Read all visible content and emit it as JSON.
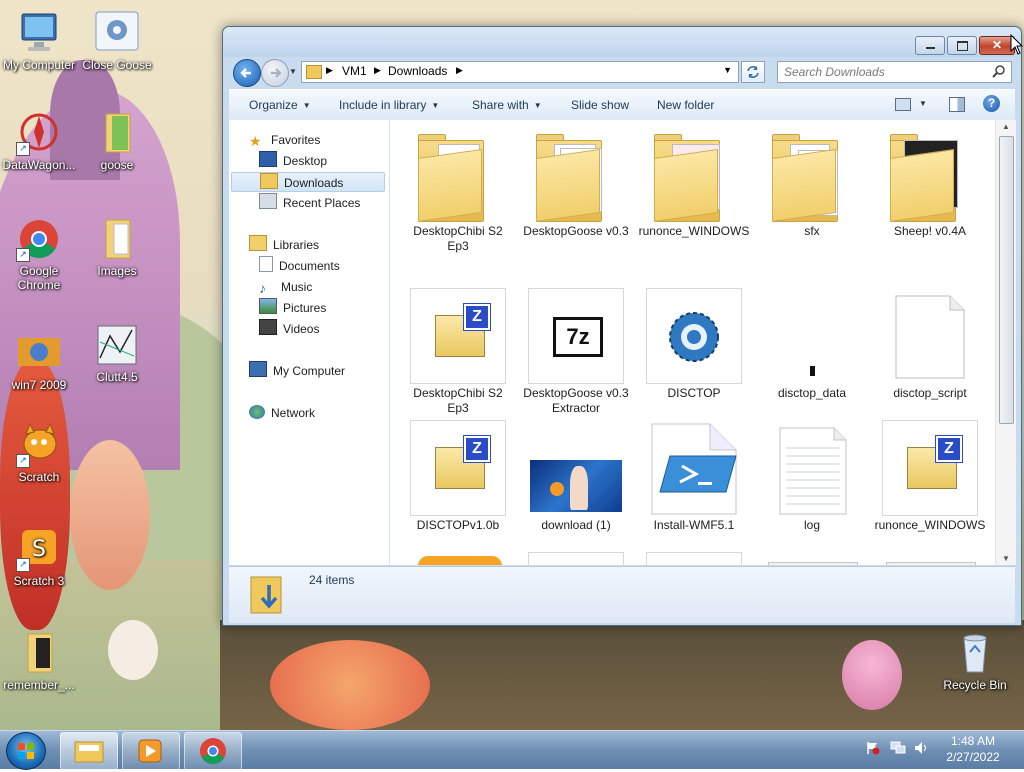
{
  "desktop": {
    "icons": [
      {
        "label": "My Computer"
      },
      {
        "label": "Close Goose"
      },
      {
        "label": "DataWagon..."
      },
      {
        "label": "goose"
      },
      {
        "label": "Google Chrome"
      },
      {
        "label": "Images"
      },
      {
        "label": "win7 2009"
      },
      {
        "label": "Clutt4.5"
      },
      {
        "label": "Scratch"
      },
      {
        "label": "Scratch 3"
      },
      {
        "label": "remember_..."
      },
      {
        "label": "Recycle Bin"
      }
    ]
  },
  "window": {
    "breadcrumb": [
      "VM1",
      "Downloads"
    ],
    "search_placeholder": "Search Downloads",
    "toolbar": {
      "organize": "Organize",
      "include_in_library": "Include in library",
      "share_with": "Share with",
      "slide_show": "Slide show",
      "new_folder": "New folder"
    },
    "nav": {
      "favorites": "Favorites",
      "desktop": "Desktop",
      "downloads": "Downloads",
      "recent_places": "Recent Places",
      "libraries": "Libraries",
      "documents": "Documents",
      "music": "Music",
      "pictures": "Pictures",
      "videos": "Videos",
      "my_computer": "My Computer",
      "network": "Network"
    },
    "files": [
      {
        "name": "DesktopChibi S2 Ep3",
        "kind": "folder"
      },
      {
        "name": "DesktopGoose v0.3",
        "kind": "folder"
      },
      {
        "name": "runonce_WINDOWS",
        "kind": "folder"
      },
      {
        "name": "sfx",
        "kind": "folder"
      },
      {
        "name": "Sheep! v0.4A",
        "kind": "folder"
      },
      {
        "name": "DesktopChibi S2 Ep3",
        "kind": "zip"
      },
      {
        "name": "DesktopGoose v0.3 Extractor",
        "kind": "7z"
      },
      {
        "name": "DISCTOP",
        "kind": "gear"
      },
      {
        "name": "disctop_data",
        "kind": "data"
      },
      {
        "name": "disctop_script",
        "kind": "blank"
      },
      {
        "name": "DISCTOPv1.0b",
        "kind": "zip"
      },
      {
        "name": "download (1)",
        "kind": "image"
      },
      {
        "name": "Install-WMF5.1",
        "kind": "powershell"
      },
      {
        "name": "log",
        "kind": "text"
      },
      {
        "name": "runonce_WINDOWS",
        "kind": "zip"
      }
    ],
    "status": {
      "count": "24 items"
    }
  },
  "taskbar": {
    "time": "1:48 AM",
    "date": "2/27/2022"
  }
}
